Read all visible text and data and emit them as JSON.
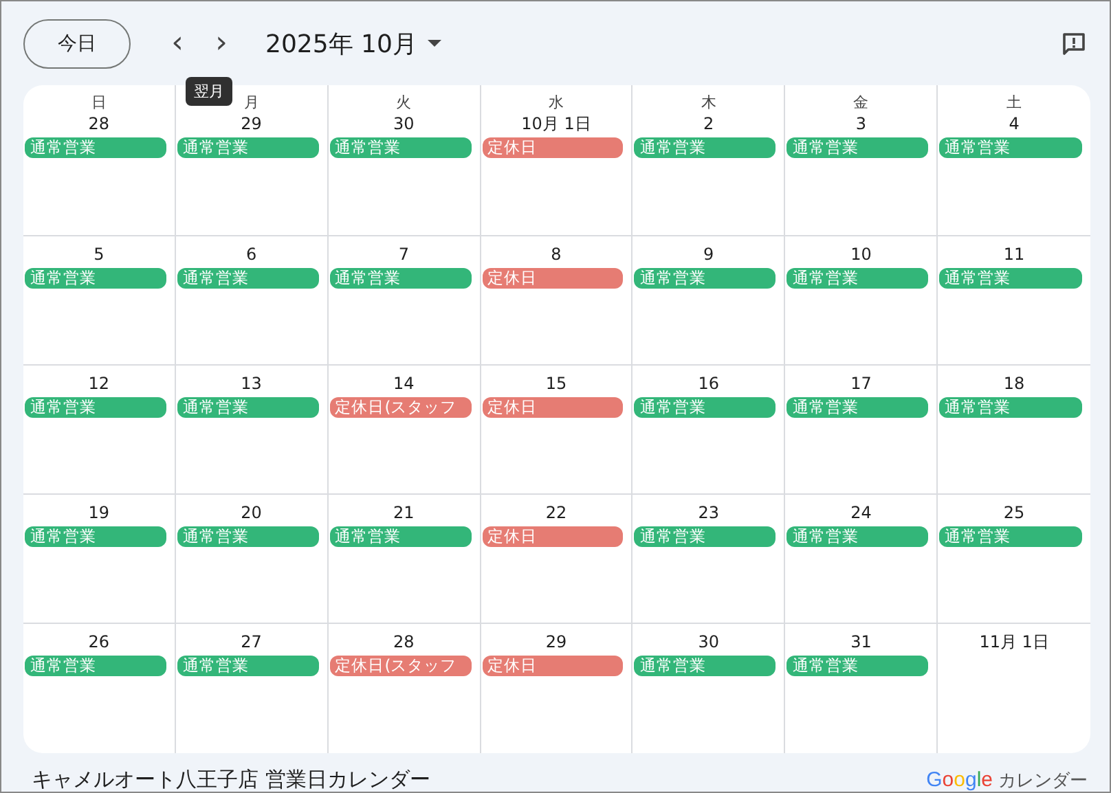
{
  "toolbar": {
    "today_button": "今日",
    "prev_button": "‹",
    "next_button": "›",
    "month_title": "2025年 10月",
    "tooltip": "翌月"
  },
  "weekdays": [
    "日",
    "月",
    "火",
    "水",
    "木",
    "金",
    "土"
  ],
  "weeks": [
    [
      {
        "date": "28",
        "events": [
          {
            "text": "通常営業",
            "color": "#33b679"
          }
        ]
      },
      {
        "date": "29",
        "events": [
          {
            "text": "通常営業",
            "color": "#33b679"
          }
        ]
      },
      {
        "date": "30",
        "events": [
          {
            "text": "通常営業",
            "color": "#33b679"
          }
        ]
      },
      {
        "date": "10月 1日",
        "events": [
          {
            "text": "定休日",
            "color": "#e67c73"
          }
        ]
      },
      {
        "date": "2",
        "events": [
          {
            "text": "通常営業",
            "color": "#33b679"
          }
        ]
      },
      {
        "date": "3",
        "events": [
          {
            "text": "通常営業",
            "color": "#33b679"
          }
        ]
      },
      {
        "date": "4",
        "events": [
          {
            "text": "通常営業",
            "color": "#33b679"
          }
        ]
      }
    ],
    [
      {
        "date": "5",
        "events": [
          {
            "text": "通常営業",
            "color": "#33b679"
          }
        ]
      },
      {
        "date": "6",
        "events": [
          {
            "text": "通常営業",
            "color": "#33b679"
          }
        ]
      },
      {
        "date": "7",
        "events": [
          {
            "text": "通常営業",
            "color": "#33b679"
          }
        ]
      },
      {
        "date": "8",
        "events": [
          {
            "text": "定休日",
            "color": "#e67c73"
          }
        ]
      },
      {
        "date": "9",
        "events": [
          {
            "text": "通常営業",
            "color": "#33b679"
          }
        ]
      },
      {
        "date": "10",
        "events": [
          {
            "text": "通常営業",
            "color": "#33b679"
          }
        ]
      },
      {
        "date": "11",
        "events": [
          {
            "text": "通常営業",
            "color": "#33b679"
          }
        ]
      }
    ],
    [
      {
        "date": "12",
        "events": [
          {
            "text": "通常営業",
            "color": "#33b679"
          }
        ]
      },
      {
        "date": "13",
        "events": [
          {
            "text": "通常営業",
            "color": "#33b679"
          }
        ]
      },
      {
        "date": "14",
        "events": [
          {
            "text": "定休日(スタッフ",
            "color": "#e67c73"
          }
        ]
      },
      {
        "date": "15",
        "events": [
          {
            "text": "定休日",
            "color": "#e67c73"
          }
        ]
      },
      {
        "date": "16",
        "events": [
          {
            "text": "通常営業",
            "color": "#33b679"
          }
        ]
      },
      {
        "date": "17",
        "events": [
          {
            "text": "通常営業",
            "color": "#33b679"
          }
        ]
      },
      {
        "date": "18",
        "events": [
          {
            "text": "通常営業",
            "color": "#33b679"
          }
        ]
      }
    ],
    [
      {
        "date": "19",
        "events": [
          {
            "text": "通常営業",
            "color": "#33b679"
          }
        ]
      },
      {
        "date": "20",
        "events": [
          {
            "text": "通常営業",
            "color": "#33b679"
          }
        ]
      },
      {
        "date": "21",
        "events": [
          {
            "text": "通常営業",
            "color": "#33b679"
          }
        ]
      },
      {
        "date": "22",
        "events": [
          {
            "text": "定休日",
            "color": "#e67c73"
          }
        ]
      },
      {
        "date": "23",
        "events": [
          {
            "text": "通常営業",
            "color": "#33b679"
          }
        ]
      },
      {
        "date": "24",
        "events": [
          {
            "text": "通常営業",
            "color": "#33b679"
          }
        ]
      },
      {
        "date": "25",
        "events": [
          {
            "text": "通常営業",
            "color": "#33b679"
          }
        ]
      }
    ],
    [
      {
        "date": "26",
        "events": [
          {
            "text": "通常営業",
            "color": "#33b679"
          }
        ]
      },
      {
        "date": "27",
        "events": [
          {
            "text": "通常営業",
            "color": "#33b679"
          }
        ]
      },
      {
        "date": "28",
        "events": [
          {
            "text": "定休日(スタッフ",
            "color": "#e67c73"
          }
        ]
      },
      {
        "date": "29",
        "events": [
          {
            "text": "定休日",
            "color": "#e67c73"
          }
        ]
      },
      {
        "date": "30",
        "events": [
          {
            "text": "通常営業",
            "color": "#33b679"
          }
        ]
      },
      {
        "date": "31",
        "events": [
          {
            "text": "通常営業",
            "color": "#33b679"
          }
        ]
      },
      {
        "date": "11月 1日"
      }
    ]
  ],
  "footer": {
    "calendar_name": "キャメルオート八王子店 営業日カレンダー",
    "logo": "Google",
    "logo_caption": "カレンダー"
  }
}
